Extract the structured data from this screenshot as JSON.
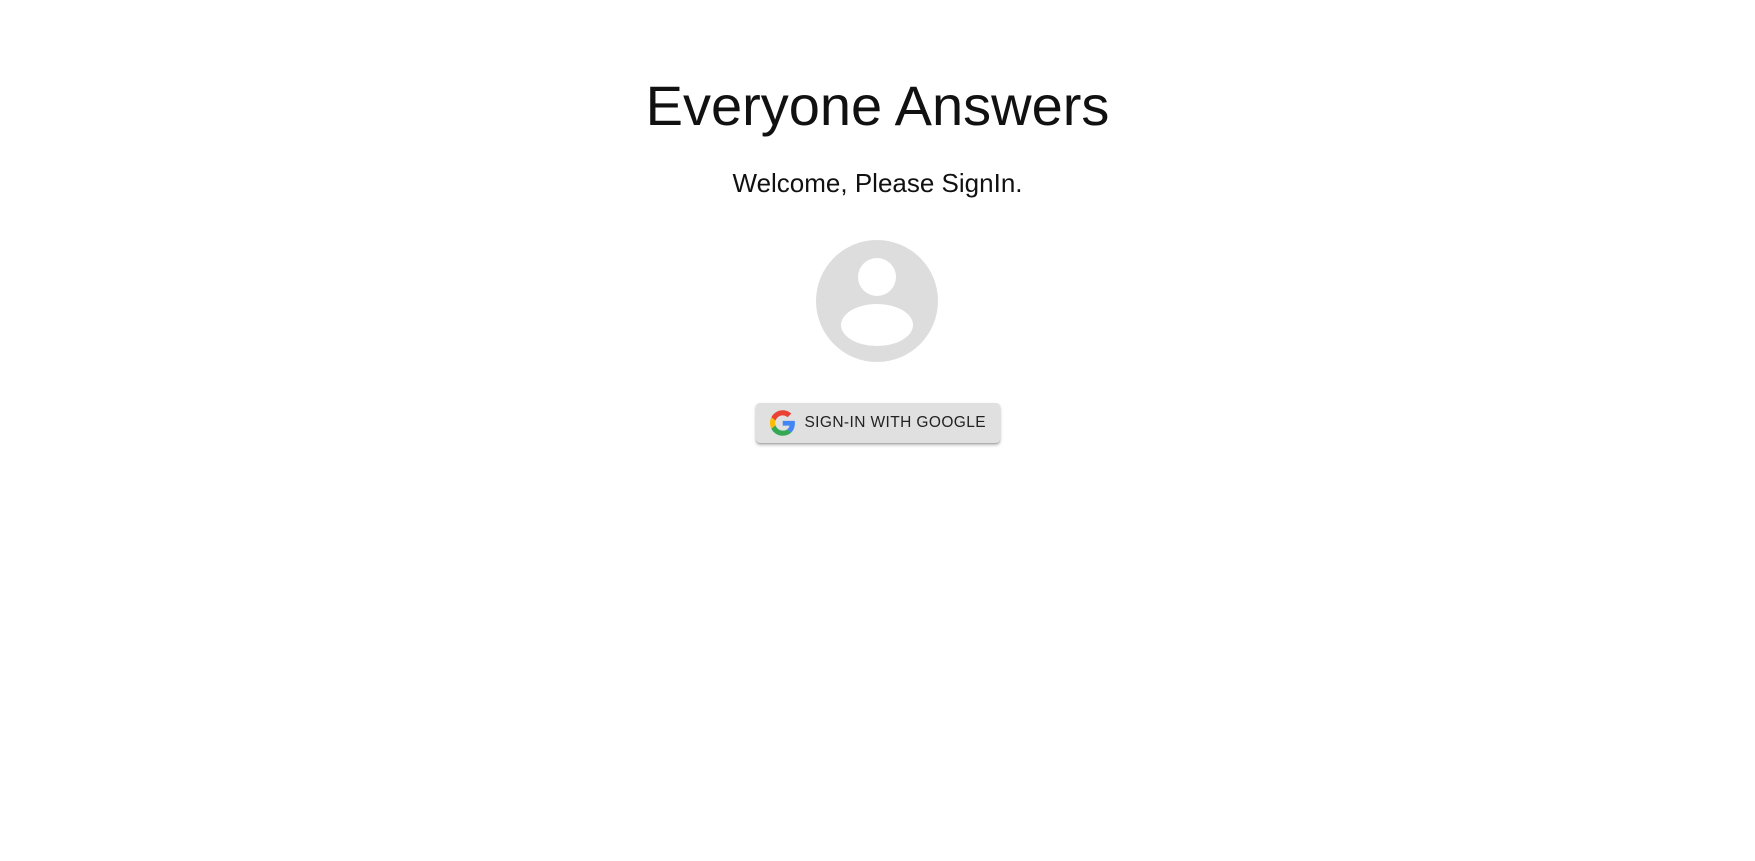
{
  "app": {
    "title": "Everyone Answers",
    "subtitle": "Welcome, Please SignIn."
  },
  "avatar": {
    "icon": "user-placeholder-icon",
    "color": "#dddddd"
  },
  "signin": {
    "label": "SIGN-IN WITH GOOGLE",
    "icon": "google-icon",
    "background": "#e0e0e0"
  }
}
